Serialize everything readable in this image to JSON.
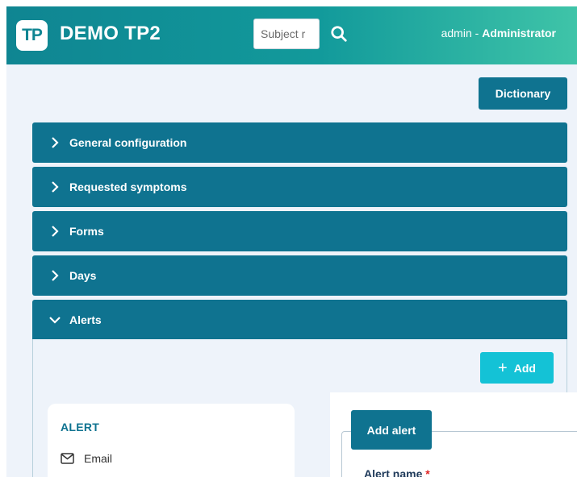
{
  "header": {
    "logo_text": "TP",
    "app_title": "DEMO TP2",
    "search_placeholder": "Subject r",
    "search_icon": "search-icon",
    "user_name": "admin",
    "user_separator": " - ",
    "user_role": "Administrator"
  },
  "toolbar": {
    "dictionary_label": "Dictionary"
  },
  "accordion": {
    "items": [
      {
        "label": "General configuration",
        "expanded": false
      },
      {
        "label": "Requested symptoms",
        "expanded": false
      },
      {
        "label": "Forms",
        "expanded": false
      },
      {
        "label": "Days",
        "expanded": false
      },
      {
        "label": "Alerts",
        "expanded": true
      }
    ]
  },
  "alerts": {
    "add_label": "Add",
    "card_title": "ALERT",
    "types": [
      {
        "label": "Email",
        "icon": "mail-icon"
      }
    ]
  },
  "add_alert": {
    "tab_label": "Add alert",
    "name_label": "Alert name",
    "required_mark": "*"
  },
  "colors": {
    "header_start": "#0f8592",
    "header_end": "#3fc4a8",
    "primary": "#0f7390",
    "accent": "#14c2d6",
    "required": "#e02424"
  }
}
